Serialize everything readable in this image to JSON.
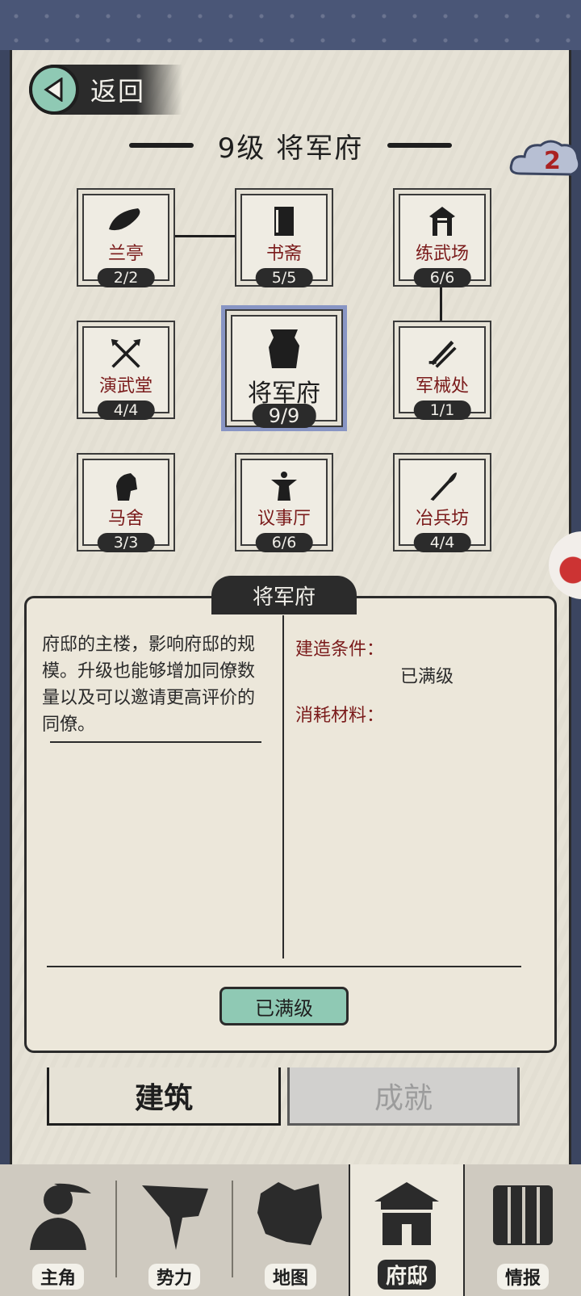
{
  "header": {
    "back_label": "返回",
    "title": "9级 将军府",
    "badge_count": "2"
  },
  "buildings": [
    {
      "name": "兰亭",
      "level": "2/2",
      "icon": "pavilion-icon"
    },
    {
      "name": "书斋",
      "level": "5/5",
      "icon": "book-icon"
    },
    {
      "name": "练武场",
      "level": "6/6",
      "icon": "warrior-icon"
    },
    {
      "name": "演武堂",
      "level": "4/4",
      "icon": "crossed-spears-icon"
    },
    {
      "name": "将军府",
      "level": "9/9",
      "icon": "general-mansion-icon"
    },
    {
      "name": "军械处",
      "level": "1/1",
      "icon": "crossed-swords-icon"
    },
    {
      "name": "马舍",
      "level": "3/3",
      "icon": "horse-icon"
    },
    {
      "name": "议事厅",
      "level": "6/6",
      "icon": "council-figure-icon"
    },
    {
      "name": "冶兵坊",
      "level": "4/4",
      "icon": "blade-icon"
    }
  ],
  "detail": {
    "tab_title": "将军府",
    "description": "府邸的主楼，影响府邸的规模。升级也能够增加同僚数量以及可以邀请更高评价的同僚。",
    "build_condition_label": "建造条件：",
    "build_condition_value": "已满级",
    "materials_label": "消耗材料：",
    "action_label": "已满级"
  },
  "tabs": {
    "building": "建筑",
    "achievement": "成就"
  },
  "bottom_nav": [
    {
      "label": "主角",
      "icon": "hero-icon"
    },
    {
      "label": "势力",
      "icon": "flag-icon"
    },
    {
      "label": "地图",
      "icon": "map-icon"
    },
    {
      "label": "府邸",
      "icon": "mansion-icon",
      "active": true
    },
    {
      "label": "情报",
      "icon": "scroll-icon"
    }
  ],
  "colors": {
    "accent_green": "#8fc9b4",
    "ink": "#1e1e1e",
    "red_text": "#7a1a1a",
    "paper": "#e6e2d6"
  }
}
